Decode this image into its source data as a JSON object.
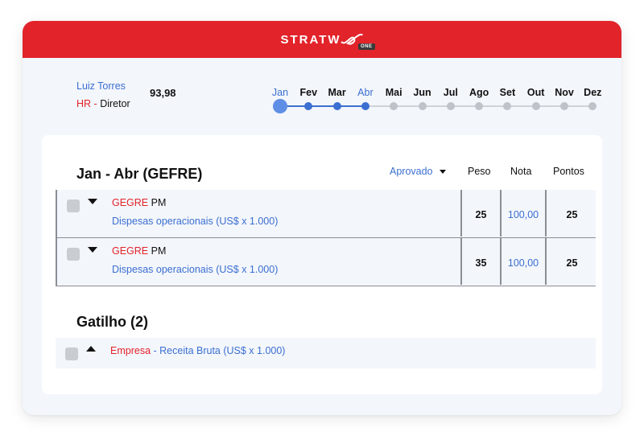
{
  "app": {
    "logo_text": "STRATW",
    "logo_badge": "ONE"
  },
  "user": {
    "name": "Luiz Torres",
    "role_code": "HR -",
    "role_title": "Diretor",
    "score": "93,98"
  },
  "timeline": {
    "months": [
      "Jan",
      "Fev",
      "Mar",
      "Abr",
      "Mai",
      "Jun",
      "Jul",
      "Ago",
      "Set",
      "Out",
      "Nov",
      "Dez"
    ],
    "current_month": "Jan",
    "highlighted_months": [
      "Jan",
      "Abr"
    ],
    "active_through": "Abr"
  },
  "period_section": {
    "title": "Jan - Abr (GEFRE)",
    "status": "Aprovado",
    "columns": {
      "weight": "Peso",
      "grade": "Nota",
      "points": "Pontos"
    },
    "rows": [
      {
        "code": "GEGRE",
        "rest": "PM",
        "description": "Dispesas operacionais (US$ x 1.000)",
        "weight": "25",
        "grade": "100,00",
        "points": "25"
      },
      {
        "code": "GEGRE",
        "rest": "PM",
        "description": "Dispesas operacionais (US$ x 1.000)",
        "weight": "35",
        "grade": "100,00",
        "points": "25"
      }
    ]
  },
  "trigger_section": {
    "title": "Gatilho (2)",
    "rows": [
      {
        "code": "Empresa",
        "rest": " - Receita Bruta (US$ x 1.000)"
      }
    ]
  },
  "colors": {
    "brand_red": "#e2232a",
    "accent_blue": "#3b6fd1",
    "background": "#f3f6fb"
  }
}
